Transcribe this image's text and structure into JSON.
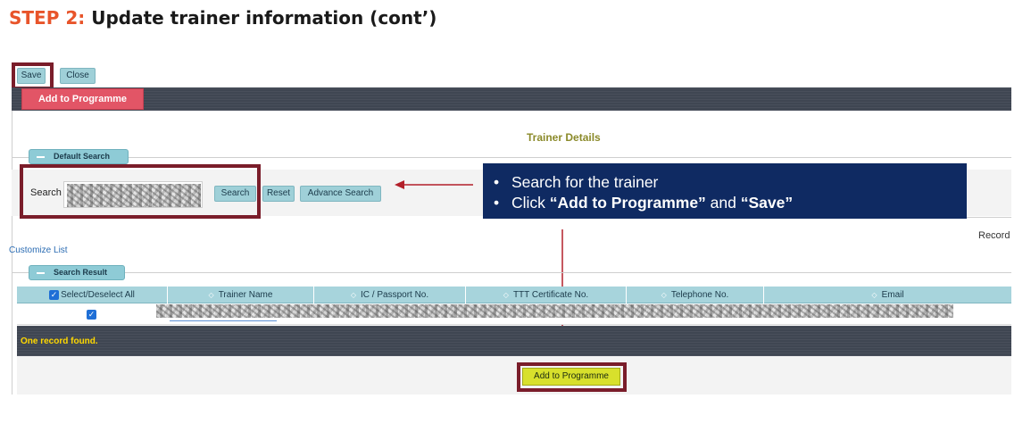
{
  "heading": {
    "step": "STEP 2:",
    "title": "Update trainer information (cont’)"
  },
  "toolbar": {
    "save_label": "Save",
    "close_label": "Close"
  },
  "tabs": {
    "add_to_programme": "Add to Programme"
  },
  "section_title": "Trainer Details",
  "default_search": {
    "legend": "Default Search",
    "search_label": "Search",
    "search_button": "Search",
    "reset_button": "Reset",
    "advance_search_button": "Advance Search"
  },
  "callout": {
    "bullet": "•",
    "line1": "Search for the trainer",
    "line2_prefix": "Click ",
    "line2_bold1": "“Add to Programme”",
    "line2_mid": " and ",
    "line2_bold2": "“Save”"
  },
  "customize_list": "Customize List",
  "records_label": "Record",
  "search_result": {
    "legend": "Search Result",
    "select_all_label": "Select/Deselect All",
    "columns": [
      "Trainer Name",
      "IC / Passport No.",
      "TTT Certificate No.",
      "Telephone No.",
      "Email"
    ],
    "sort_icon": "◇",
    "status": "One record found.",
    "add_button": "Add to Programme"
  },
  "colors": {
    "step_accent": "#e8542a",
    "callout_bg": "#0f2a62",
    "highlight_border": "#7a1d2a",
    "tab_red": "#e25566",
    "status_yellow": "#ffd800"
  }
}
